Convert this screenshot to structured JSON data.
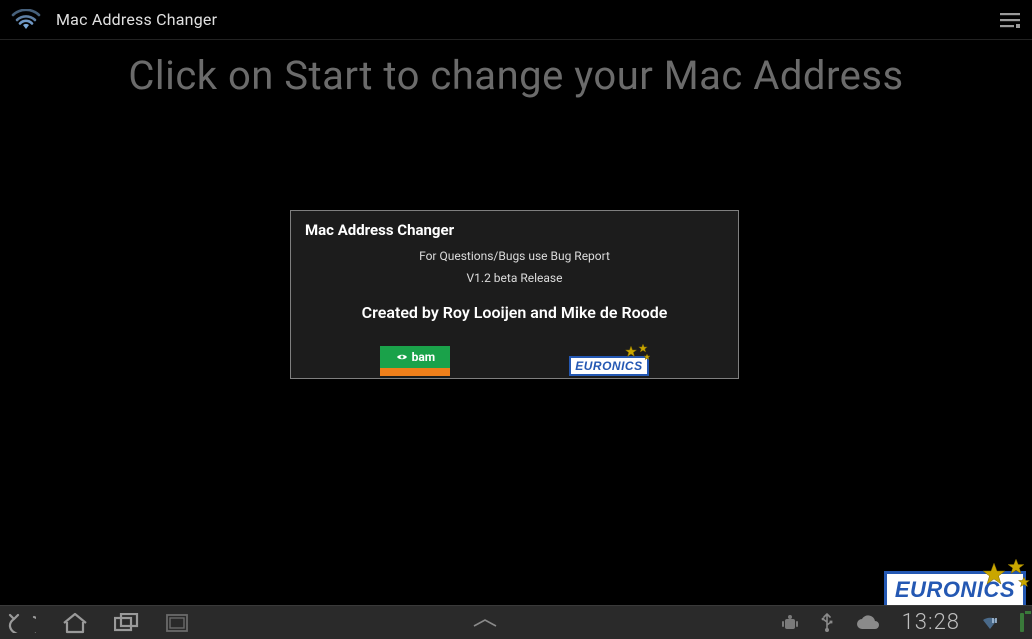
{
  "appbar": {
    "title": "Mac Address Changer"
  },
  "hero": "Click on Start to change your Mac Address",
  "dialog": {
    "title": "Mac Address Changer",
    "hint": "For Questions/Bugs use Bug Report",
    "version": "V1.2 beta Release",
    "authors": "Created by Roy Looijen and Mike de Roode",
    "logo_bam": "bam",
    "logo_euronics": "EURONICS"
  },
  "corner_logo": "EURONICS",
  "statusbar": {
    "clock": "13:28"
  }
}
